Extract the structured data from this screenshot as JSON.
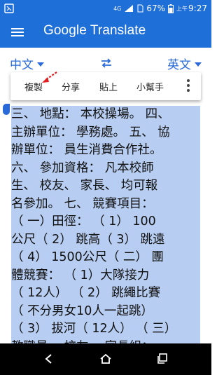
{
  "status_bar": {
    "network": "4G",
    "battery_percent": "67%",
    "time_prefix": "上午",
    "time": "9:27"
  },
  "app_bar": {
    "title": "Google Translate"
  },
  "languages": {
    "source": "中文",
    "target": "英文"
  },
  "selection_toolbar": {
    "items": [
      "複製",
      "分享",
      "貼上",
      "小幫手"
    ]
  },
  "source_text": {
    "lines": [
      "三、 地點： 本校操場。 四、",
      "主辦單位： 學務處。 五、 協",
      "辦單位： 員生消費合作社。",
      "六、 參加資格： 凡本校師",
      "生、 校友、 家長、 均可報",
      "名參加。 七、 競賽項目：",
      "（ 一）田徑： （ 1） 100",
      "公尺（ 2） 跳高（ 3） 跳遠",
      "（ 4） 1500公尺（ 二） 團",
      "體競賽： （ 1）大隊接力",
      "（ 12人） （ 2） 跳繩比賽",
      "（ 不分男女10人一起跳）",
      "（ 3） 拔河（ 12人） （ 三）",
      "教職員、 校友、 家長組："
    ]
  },
  "colors": {
    "app_bar": "#1f6fd8",
    "accent": "#2a6ad8",
    "selection": "#b7cdf1",
    "annotation_arrow": "#e02020"
  },
  "icons": {
    "menu": "menu-icon",
    "swap": "swap-icon",
    "more": "more-vert-icon",
    "back": "back-icon",
    "home": "home-icon",
    "recents": "recents-icon"
  }
}
